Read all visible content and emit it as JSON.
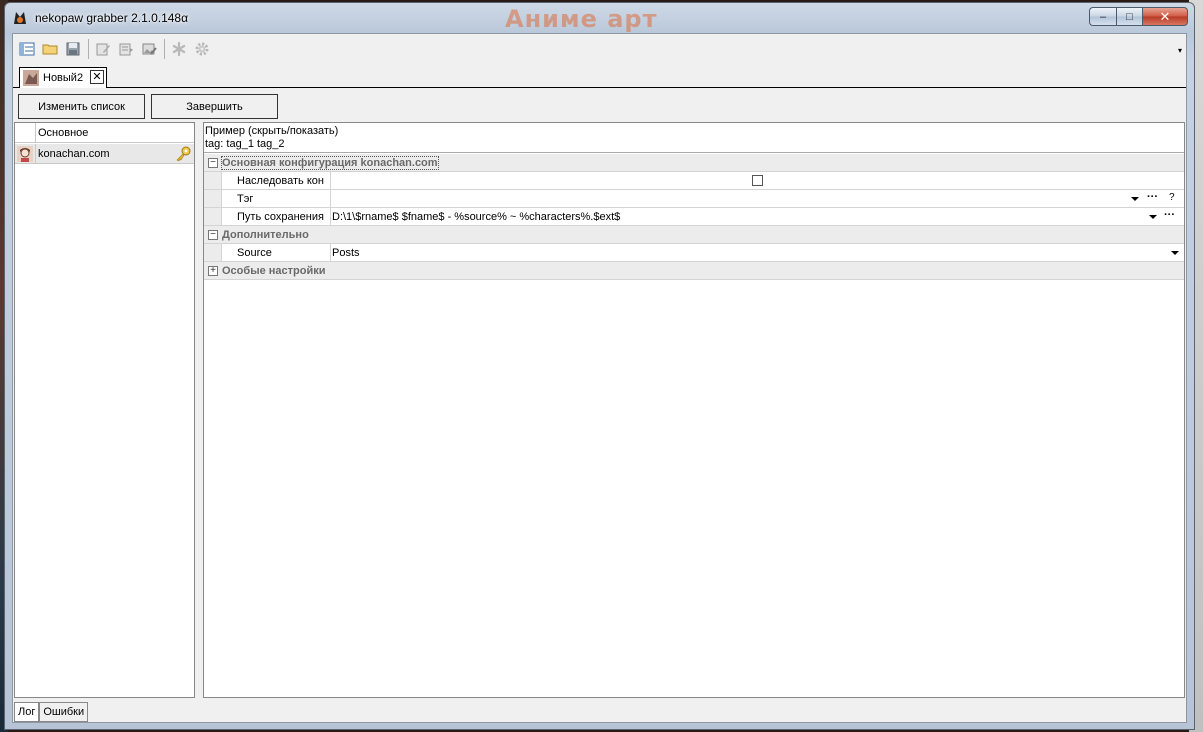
{
  "window": {
    "title": "nekopaw grabber 2.1.0.148α",
    "watermark": "Аниме арт",
    "controls": {
      "minimize": "–",
      "maximize": "□",
      "close": "✕"
    }
  },
  "toolbar": {
    "items": [
      "new-list-icon",
      "open-folder-icon",
      "save-icon",
      "edit-icon",
      "edit-list-icon",
      "image-edit-icon",
      "asterisk-icon",
      "gear-icon"
    ],
    "overflow": "▾"
  },
  "tabs": [
    {
      "label": "Новый2",
      "close": "✕"
    }
  ],
  "actions": {
    "edit_list": "Изменить список",
    "finish": "Завершить"
  },
  "resource_list": {
    "header": "Основное",
    "items": [
      {
        "label": "konachan.com"
      }
    ]
  },
  "example": {
    "line1": "Пример (скрыть/показать)",
    "line2": "tag: tag_1 tag_2"
  },
  "property_grid": {
    "cat_main": {
      "expander": "−",
      "label": "Основная конфигурация konachan.com"
    },
    "inherit": {
      "label": "Наследовать кон",
      "checked": false
    },
    "tag": {
      "label": "Тэг",
      "value": "",
      "dots": "···",
      "help": "?"
    },
    "save_path": {
      "label": "Путь сохранения",
      "value": "D:\\1\\$rname$ $fname$ - %source% ~ %characters%.$ext$",
      "dots": "···"
    },
    "cat_extra": {
      "expander": "−",
      "label": "Дополнительно"
    },
    "source": {
      "label": "Source",
      "value": "Posts"
    },
    "cat_special": {
      "expander": "+",
      "label": "Особые настройки"
    }
  },
  "bottom_tabs": {
    "log": "Лог",
    "errors": "Ошибки"
  }
}
